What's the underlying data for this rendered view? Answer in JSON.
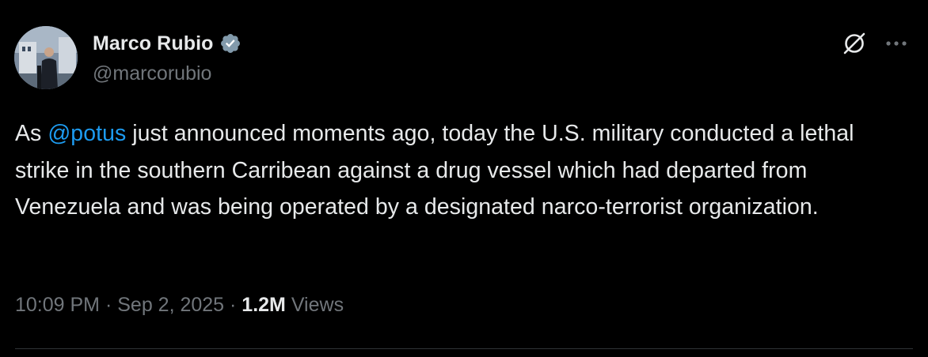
{
  "author": {
    "display_name": "Marco Rubio",
    "handle": "@marcorubio",
    "verified_badge_color": "#829aab"
  },
  "tweet": {
    "text_before_mention": "As ",
    "mention": "@potus",
    "text_after_mention": " just announced moments ago, today the U.S. military conducted a lethal strike in the southern Carribean against a drug vessel which had departed from Venezuela and was being operated by a designated narco-terrorist organization."
  },
  "meta": {
    "time": "10:09 PM",
    "separator_1": " · ",
    "date": "Sep 2, 2025",
    "separator_2": " · ",
    "views_count": "1.2M",
    "views_label": " Views"
  },
  "icons": {
    "grok": "grok-icon",
    "more": "more-dots-icon",
    "verified": "verified-badge-icon"
  },
  "colors": {
    "background": "#000000",
    "primary_text": "#e7e9ea",
    "secondary_text": "#71767b",
    "link": "#1d9bf0",
    "divider": "#2f3336"
  }
}
